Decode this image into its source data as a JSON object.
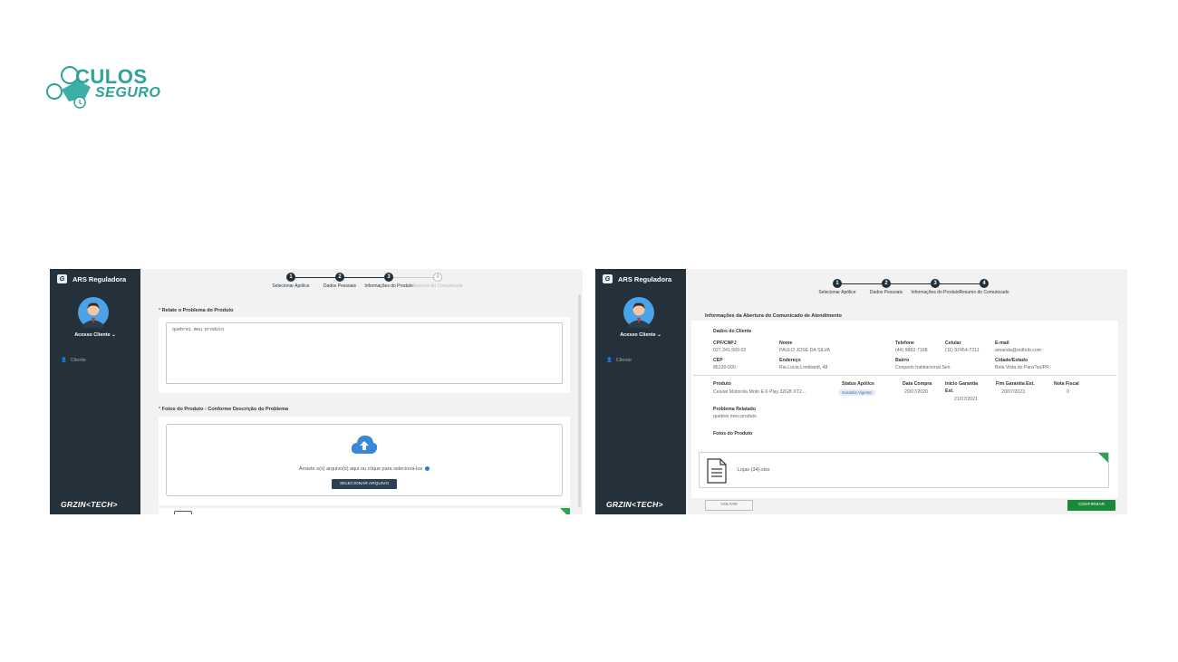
{
  "brand": {
    "line1": "CULOS",
    "line2": "SEGURO",
    "color": "#2aa39a"
  },
  "app": {
    "name": "ARS Reguladora",
    "user_menu": "Acesso Cliente",
    "nav_item": "Cliente",
    "footer_logo": "GRZIN<TECH>",
    "sidebar_color": "#25313a"
  },
  "left": {
    "steps": [
      {
        "number": "1",
        "label": "Selecionar Apólice"
      },
      {
        "number": "2",
        "label": "Dados Pessoais"
      },
      {
        "number": "3",
        "label": "Informações do Produto"
      },
      {
        "number": "4",
        "label": "Resumo do Comunicado"
      }
    ],
    "problem_title": "Relate o Problema do Produto",
    "problem_value": "quebrei meu produto",
    "photos_title": "Fotos do Produto - Conforme Descrição do Problema",
    "dropzone_text": "Arraste o(s) arquivo(s) aqui ou clique para selecioná-los",
    "select_button": "SELECIONAR ARQUIVO"
  },
  "right": {
    "steps": [
      {
        "number": "1",
        "label": "Selecionar Apólice"
      },
      {
        "number": "2",
        "label": "Dados Pessoais"
      },
      {
        "number": "3",
        "label": "Informações do Produto"
      },
      {
        "number": "4",
        "label": "Resumo do Comunicado"
      }
    ],
    "section_title": "Informações da Abertura do Comunicado de Atendimento",
    "client": {
      "title": "Dados do Cliente",
      "cpf_label": "CPF/CNPJ",
      "cpf": "027.241.509-02",
      "name_label": "Nome",
      "name": "PAULO JOSÉ DA SILVA",
      "phone_label": "Telefone",
      "phone": "(44) 9882-7168",
      "mobile_label": "Celular",
      "mobile": "(11) 97454-7211",
      "email_label": "E-mail",
      "email": "amanda@outhub.com",
      "cep_label": "CEP",
      "cep": "86130-000",
      "address_label": "Endereço",
      "address": "Ria Lucia Lombardi, 48",
      "district_label": "Bairro",
      "district": "Conjunto habitacional Sen",
      "city_label": "Cidade/Estado",
      "city": "Bela Vista do Para?so/PR"
    },
    "product": {
      "product_label": "Produto",
      "product": "Celular Motorola Moto E-6 Play 32GB XT2...",
      "status_label": "Status Apólice",
      "status": "Garantia Vigente",
      "purchase_label": "Data Compra",
      "purchase": "20/07/2020",
      "start_label": "Inicio Garantia Est.",
      "start": "21/07/2021",
      "end_label": "Fim Garantia Est.",
      "end": "20/07/2023",
      "invoice_label": "Nota Fiscal",
      "invoice": "0",
      "problem_label": "Problema Relatado",
      "problem": "quebrei meu produto",
      "photos_label": "Fotos do Produto",
      "file_name": "Lojas (34).xlsx"
    },
    "back_button": "VOLTAR",
    "confirm_button": "CONFIRMAR",
    "confirm_color": "#1a8a3a"
  }
}
